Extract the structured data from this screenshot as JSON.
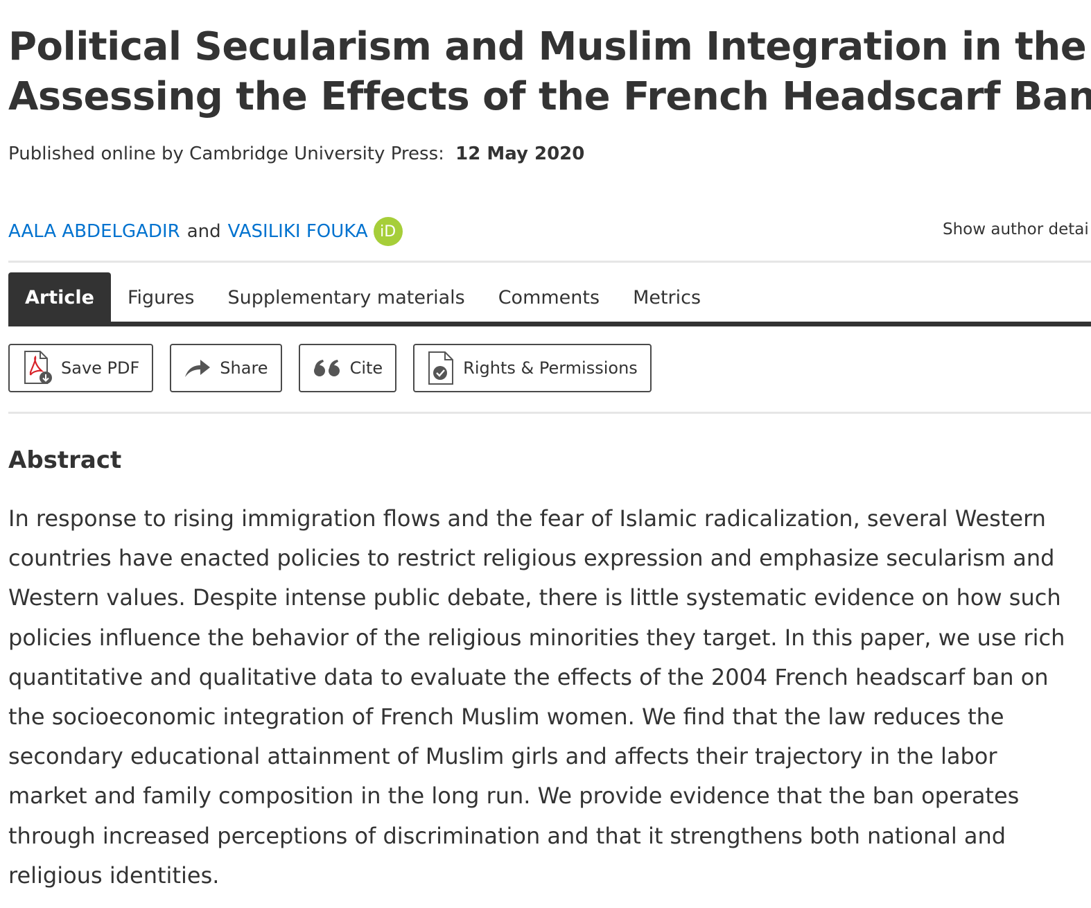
{
  "article": {
    "title_line1": "Political Secularism and Muslim Integration in the West:",
    "title_line2": "Assessing the Effects of the French Headscarf Ban",
    "published_label": "Published online by Cambridge University Press:",
    "published_date": "12 May 2020"
  },
  "authors": {
    "author1": "AALA ABDELGADIR",
    "conjunction": "and",
    "author2": "VASILIKI FOUKA",
    "orcid_label": "iD",
    "show_details": "Show author detai"
  },
  "tabs": [
    {
      "label": "Article",
      "active": true
    },
    {
      "label": "Figures",
      "active": false
    },
    {
      "label": "Supplementary materials",
      "active": false
    },
    {
      "label": "Comments",
      "active": false
    },
    {
      "label": "Metrics",
      "active": false
    }
  ],
  "toolbar": {
    "save_pdf": "Save PDF",
    "share": "Share",
    "cite": "Cite",
    "rights": "Rights & Permissions"
  },
  "abstract": {
    "heading": "Abstract",
    "lines": [
      "In response to rising immigration flows and the fear of Islamic radicalization, several Western",
      "countries have enacted policies to restrict religious expression and emphasize secularism and",
      "Western values. Despite intense public debate, there is little systematic evidence on how such",
      "policies influence the behavior of the religious minorities they target. In this paper, we use rich",
      "quantitative and qualitative data to evaluate the effects of the 2004 French headscarf ban on",
      "the socioeconomic integration of French Muslim women. We find that the law reduces the",
      "secondary educational attainment of Muslim girls and affects their trajectory in the labor",
      "market and family composition in the long run. We provide evidence that the ban operates",
      "through increased perceptions of discrimination and that it strengthens both national and",
      "religious identities."
    ]
  },
  "colors": {
    "text": "#333333",
    "link": "#0072cf",
    "orcid": "#a6ce39",
    "pdf_red": "#d8232a"
  }
}
